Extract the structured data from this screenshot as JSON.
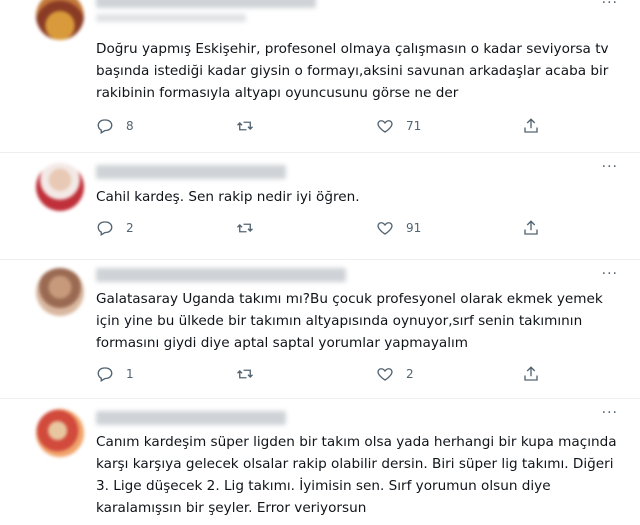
{
  "tweets": [
    {
      "text": "Doğru yapmış Eskişehir, profesonel olmaya çalışmasın o kadar seviyorsa tv başında istediği kadar giysin o formayı,aksini savunan arkadaşlar acaba bir rakibinin formasıyla altyapı oyuncusunu görse ne der",
      "reply_count": "8",
      "retweet_count": "",
      "like_count": "71"
    },
    {
      "text": "Cahil kardeş. Sen rakip nedir iyi öğren.",
      "reply_count": "2",
      "retweet_count": "",
      "like_count": "91"
    },
    {
      "text": "Galatasaray Uganda takımı mı?Bu çocuk profesyonel olarak ekmek yemek için yine bu ülkede bir takımın altyapısında oynuyor,sırf senin takımının formasını giydi diye aptal saptal yorumlar yapmayalım",
      "reply_count": "1",
      "retweet_count": "",
      "like_count": "2"
    },
    {
      "text": "Canım kardeşim süper ligden bir takım olsa yada herhangi bir kupa maçında karşı karşıya gelecek olsalar rakip olabilir dersin. Biri süper lig takımı. Diğeri 3. Lige düşecek 2. Lig takımı.  İyimisin sen. Sırf yorumun olsun diye karalamışsın bir şeyler. Error veriyorsun"
    }
  ],
  "more_label": "···",
  "icons": {
    "reply": "reply-icon",
    "retweet": "retweet-icon",
    "like": "like-icon",
    "share": "share-icon",
    "more": "more-options-icon"
  },
  "colors": {
    "text": "#0f1419",
    "muted": "#536471",
    "divider": "#eceef0"
  }
}
